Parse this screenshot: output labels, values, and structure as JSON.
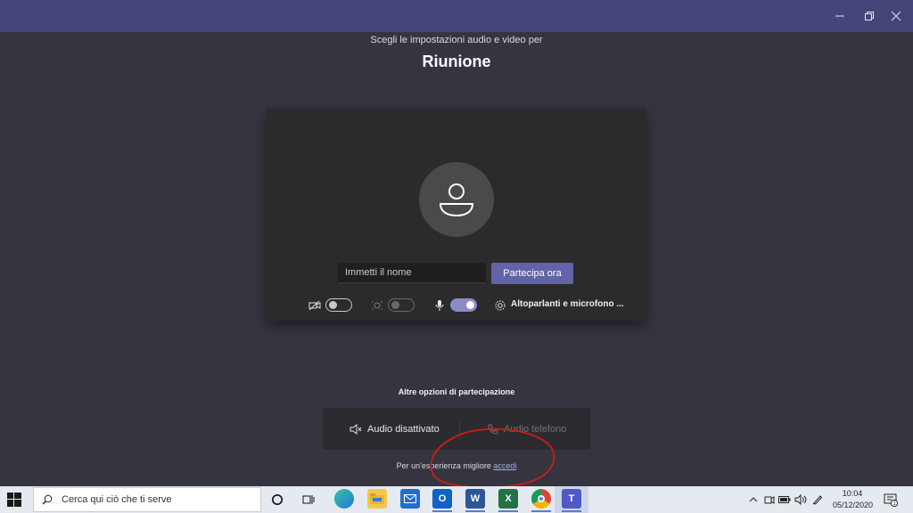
{
  "window": {
    "minimize_icon": "minimize-icon",
    "maximize_icon": "restore-icon",
    "close_icon": "close-icon",
    "title_bar_color": "#45457a"
  },
  "header": {
    "subtitle": "Scegli le impostazioni audio e video per",
    "title": "Riunione"
  },
  "preview": {
    "name_placeholder": "Immetti il nome",
    "join_label": "Partecipa ora",
    "accent": "#6264a7",
    "camera_toggle": false,
    "blur_toggle": false,
    "mic_toggle": true,
    "devices_label": "Altoparlanti e microfono ..."
  },
  "other_options": {
    "title": "Altre opzioni di partecipazione",
    "audio_off_label": "Audio disattivato",
    "phone_audio_label": "Audio telefono",
    "better_prefix": "Per un'esperienza migliore ",
    "signin_link": "accedi"
  },
  "taskbar": {
    "search_placeholder": "Cerca qui ciò che ti serve",
    "clock_time": "10:04",
    "clock_date": "05/12/2020",
    "notification_count": "1"
  }
}
